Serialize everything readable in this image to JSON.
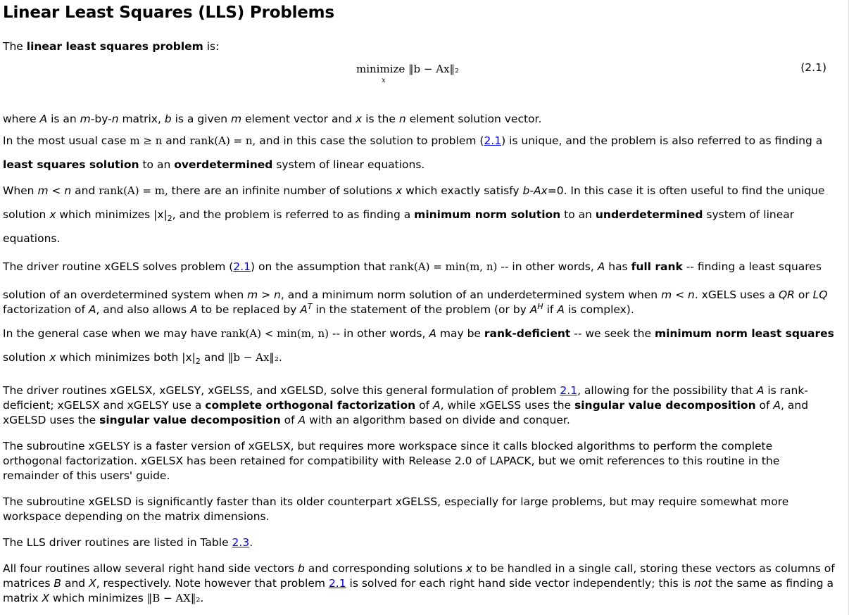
{
  "heading": "Linear Least Squares (LLS) Problems",
  "intro": {
    "pre": "The ",
    "bold": "linear least squares problem",
    "post": " is:"
  },
  "equation": {
    "main": "minimize ‖b − Ax‖₂",
    "sub": "x",
    "number": "(2.1)"
  },
  "p1": {
    "s0": "where ",
    "A": "A",
    "s1": " is an ",
    "m": "m",
    "s2": "-by-",
    "n": "n",
    "s3": " matrix, ",
    "b": "b",
    "s4": " is a given ",
    "m2": "m",
    "s5": " element vector and ",
    "x": "x",
    "s6": " is the ",
    "n2": "n",
    "s7": " element solution vector."
  },
  "p2": {
    "s0": "In the most usual case ",
    "m1": "m ≥ n",
    "s1": " and ",
    "m2": "rank(A) = n,",
    "s2": " and in this case the solution to problem (",
    "ref": "2.1",
    "s3": ") is unique, and the problem is also referred to as finding a",
    "b1": "least squares solution",
    "s4": " to an ",
    "b2": "overdetermined",
    "s5": " system of linear equations."
  },
  "p3": {
    "s0": "When ",
    "i1": "m < n",
    "s1": " and ",
    "m1": "rank(A) = m,",
    "s2": " there are an infinite number of solutions ",
    "x": "x",
    "s3": " which exactly satisfy ",
    "i2": "b-Ax",
    "s4": "=0. In this case it is often useful to find the unique",
    "s5": "solution ",
    "x2": "x",
    "s6": " which minimizes |x|",
    "sub": "2",
    "s7": ", and the problem is referred to as finding a ",
    "b1": "minimum norm solution",
    "s8": " to an ",
    "b2": "underdetermined",
    "s9": " system of linear equations."
  },
  "p4": {
    "s0": "The driver routine xGELS solves problem (",
    "ref": "2.1",
    "s1": ") on the assumption that ",
    "m1": "rank(A) = min(m, n)",
    "s2": " -- in other words, ",
    "A": "A",
    "s3": " has ",
    "b1": "full rank",
    "s4": " -- finding a least squares",
    "s5": "solution of an overdetermined system when ",
    "i1": "m > n",
    "s6": ", and a minimum norm solution of an underdetermined system when ",
    "i2": "m < n",
    "s7": ". xGELS uses a ",
    "QR": "QR",
    "s8": " or ",
    "LQ": "LQ",
    "s9": "factorization of ",
    "A2": "A",
    "s10": ", and also allows ",
    "A3": "A",
    "s11": " to be replaced by ",
    "A4": "A",
    "supT": "T",
    "s12": " in the statement of the problem (or by ",
    "A5": "A",
    "supH": "H",
    "s13": " if ",
    "A6": "A",
    "s14": " is complex)."
  },
  "p5": {
    "s0": "In the general case when we may have ",
    "m1": "rank(A) < min(m, n)",
    "s1": " -- in other words, ",
    "A": "A",
    "s2": " may be ",
    "b1": "rank-deficient",
    "s3": " -- we seek the ",
    "b2": "minimum norm least squares",
    "s4": "solution ",
    "x": "x",
    "s5": " which minimizes both |x|",
    "sub": "2",
    "s6": " and ",
    "m2": "‖b − Ax‖₂",
    "s7": "."
  },
  "p6": {
    "s0": "The driver routines xGELSX, xGELSY, xGELSS, and xGELSD, solve this general formulation of problem ",
    "ref": "2.1",
    "s1": ", allowing for the possibility that ",
    "A": "A",
    "s2": " is rank-deficient; xGELSX and xGELSY use a ",
    "b1": "complete orthogonal factorization",
    "s3": " of ",
    "A2": "A",
    "s4": ", while xGELSS uses the ",
    "b2": "singular value decomposition",
    "s5": " of ",
    "A3": "A",
    "s6": ", and xGELSD uses the ",
    "b3": "singular value decomposition",
    "s7": " of ",
    "A4": "A",
    "s8": " with an algorithm based on divide and conquer."
  },
  "p7": "The subroutine xGELSY is a faster version of xGELSX, but requires more workspace since it calls blocked algorithms to perform the complete orthogonal factorization. xGELSX has been retained for compatibility with Release 2.0 of LAPACK, but we omit references to this routine in the remainder of this users' guide.",
  "p8": "The subroutine xGELSD is significantly faster than its older counterpart xGELSS, especially for large problems, but may require somewhat more workspace depending on the matrix dimensions.",
  "p9": {
    "s0": "The LLS driver routines are listed in Table ",
    "ref": "2.3",
    "s1": "."
  },
  "p10": {
    "s0": "All four routines allow several right hand side vectors ",
    "b": "b",
    "s1": " and corresponding solutions ",
    "x": "x",
    "s2": " to be handled in a single call, storing these vectors as columns of matrices ",
    "B": "B",
    "s3": " and ",
    "X": "X",
    "s4": ", respectively. Note however that problem ",
    "ref": "2.1",
    "s5": " is solved for each right hand side vector independently; this is ",
    "not": "not",
    "s6": " the same as finding a matrix ",
    "X2": "X",
    "s7": " which minimizes ",
    "m1": "‖B − AX‖₂",
    "s8": "."
  }
}
